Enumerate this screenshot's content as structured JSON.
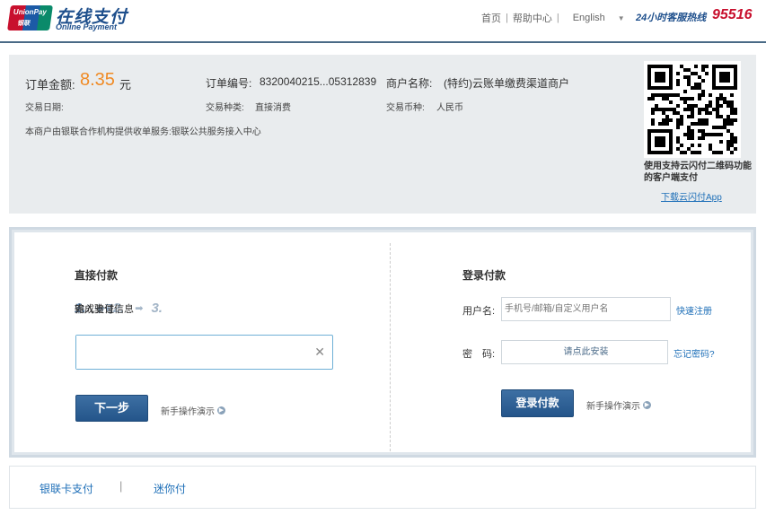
{
  "header": {
    "logo_en": "UnionPay",
    "logo_cn": "银联",
    "title": "在线支付",
    "subtitle": "Online Payment",
    "nav": {
      "home": "首页",
      "help": "帮助中心",
      "language": "English"
    },
    "hotline_label": "24小时客服热线",
    "hotline_number": "95516"
  },
  "order": {
    "amount_label": "订单金额:",
    "amount": "8.35",
    "currency_unit": "元",
    "order_no_label": "订单编号:",
    "order_no": "8320040215...05312839",
    "merchant_label": "商户名称:",
    "merchant": "(特约)云账单缴费渠道商户",
    "date_label": "交易日期:",
    "type_label": "交易种类:",
    "type": "直接消费",
    "currency_label": "交易币种:",
    "currency": "人民币",
    "provider_note": "本商户由银联合作机构提供收单服务:银联公共服务接入中心",
    "qr_text": "使用支持云闪付二维码功能的客户端支付",
    "download_link": "下载云闪付App"
  },
  "direct_pay": {
    "title": "直接付款",
    "steps": [
      {
        "num": "1.",
        "label": "输入卡号"
      },
      {
        "num": "2.",
        "label": "输入验证信息"
      },
      {
        "num": "3.",
        "label": "完成支付"
      }
    ],
    "card_value": "",
    "next_button": "下一步",
    "guide": "新手操作演示"
  },
  "login_pay": {
    "title": "登录付款",
    "username_label": "用户名:",
    "username_placeholder": "手机号/邮箱/自定义用户名",
    "register_link": "快速注册",
    "password_label": "密　码:",
    "password_install": "请点此安装",
    "forgot_link": "忘记密码?",
    "login_button": "登录付款",
    "guide": "新手操作演示"
  },
  "footer": {
    "link1": "银联卡支付",
    "link2": "迷你付"
  },
  "colors": {
    "brand_blue": "#1e4f8c",
    "amount_orange": "#f08a24",
    "hotline_red": "#c8102e",
    "link_blue": "#1e6fb8"
  }
}
